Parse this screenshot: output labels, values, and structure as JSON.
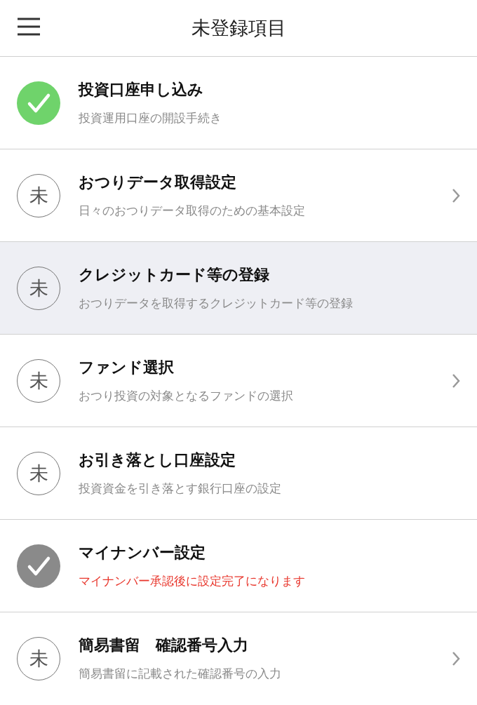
{
  "header": {
    "title": "未登録項目"
  },
  "items": [
    {
      "kind": "complete",
      "title": "投資口座申し込み",
      "subtitle": "投資運用口座の開設手続き",
      "alert": false,
      "chevron": false,
      "selected": false
    },
    {
      "kind": "unregistered",
      "badge": "未",
      "title": "おつりデータ取得設定",
      "subtitle": "日々のおつりデータ取得のための基本設定",
      "alert": false,
      "chevron": true,
      "selected": false
    },
    {
      "kind": "unregistered",
      "badge": "未",
      "title": "クレジットカード等の登録",
      "subtitle": "おつりデータを取得するクレジットカード等の登録",
      "alert": false,
      "chevron": false,
      "selected": true
    },
    {
      "kind": "unregistered",
      "badge": "未",
      "title": "ファンド選択",
      "subtitle": "おつり投資の対象となるファンドの選択",
      "alert": false,
      "chevron": true,
      "selected": false
    },
    {
      "kind": "unregistered",
      "badge": "未",
      "title": "お引き落とし口座設定",
      "subtitle": "投資資金を引き落とす銀行口座の設定",
      "alert": false,
      "chevron": false,
      "selected": false
    },
    {
      "kind": "pending",
      "title": "マイナンバー設定",
      "subtitle": "マイナンバー承認後に設定完了になります",
      "alert": true,
      "chevron": false,
      "selected": false
    },
    {
      "kind": "unregistered",
      "badge": "未",
      "title": "簡易書留　確認番号入力",
      "subtitle": "簡易書留に記載された確認番号の入力",
      "alert": false,
      "chevron": true,
      "selected": false
    }
  ]
}
